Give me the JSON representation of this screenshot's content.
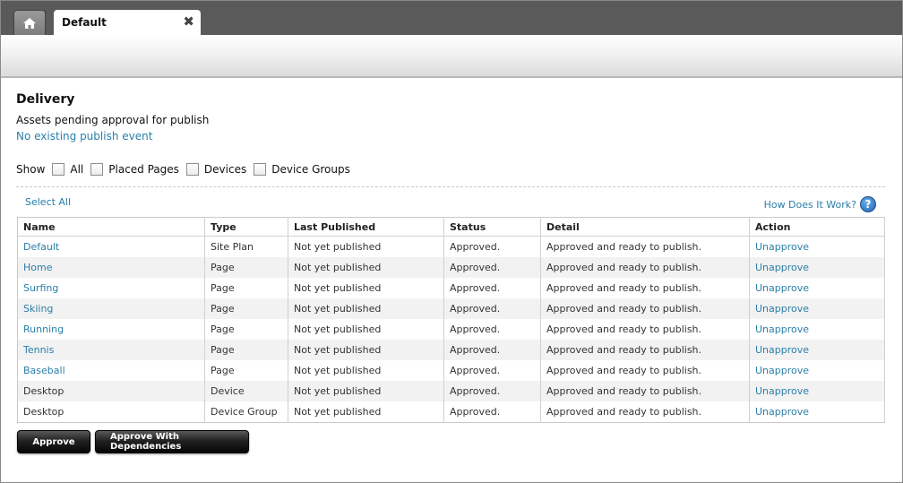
{
  "tabs": {
    "home_icon": "home-icon",
    "active_tab_label": "Default",
    "close_glyph": "✖"
  },
  "page": {
    "title": "Delivery",
    "subtitle": "Assets pending approval for publish",
    "no_event_link": "No existing publish event"
  },
  "filters": {
    "show_label": "Show",
    "options": [
      {
        "label": "All",
        "checked": false
      },
      {
        "label": "Placed Pages",
        "checked": false
      },
      {
        "label": "Devices",
        "checked": false
      },
      {
        "label": "Device Groups",
        "checked": false
      }
    ]
  },
  "links": {
    "select_all": "Select All",
    "how_does_it_work": "How Does It Work?",
    "help_glyph": "?"
  },
  "table": {
    "headers": [
      "Name",
      "Type",
      "Last Published",
      "Status",
      "Detail",
      "Action"
    ],
    "rows": [
      {
        "name": "Default",
        "name_link": true,
        "type": "Site Plan",
        "last_published": "Not yet published",
        "status": "Approved.",
        "detail": "Approved and ready to publish.",
        "action": "Unapprove"
      },
      {
        "name": "Home",
        "name_link": true,
        "type": "Page",
        "last_published": "Not yet published",
        "status": "Approved.",
        "detail": "Approved and ready to publish.",
        "action": "Unapprove"
      },
      {
        "name": "Surfing",
        "name_link": true,
        "type": "Page",
        "last_published": "Not yet published",
        "status": "Approved.",
        "detail": "Approved and ready to publish.",
        "action": "Unapprove"
      },
      {
        "name": "Skiing",
        "name_link": true,
        "type": "Page",
        "last_published": "Not yet published",
        "status": "Approved.",
        "detail": "Approved and ready to publish.",
        "action": "Unapprove"
      },
      {
        "name": "Running",
        "name_link": true,
        "type": "Page",
        "last_published": "Not yet published",
        "status": "Approved.",
        "detail": "Approved and ready to publish.",
        "action": "Unapprove"
      },
      {
        "name": "Tennis",
        "name_link": true,
        "type": "Page",
        "last_published": "Not yet published",
        "status": "Approved.",
        "detail": "Approved and ready to publish.",
        "action": "Unapprove"
      },
      {
        "name": "Baseball",
        "name_link": true,
        "type": "Page",
        "last_published": "Not yet published",
        "status": "Approved.",
        "detail": "Approved and ready to publish.",
        "action": "Unapprove"
      },
      {
        "name": "Desktop",
        "name_link": false,
        "type": "Device",
        "last_published": "Not yet published",
        "status": "Approved.",
        "detail": "Approved and ready to publish.",
        "action": "Unapprove"
      },
      {
        "name": "Desktop",
        "name_link": false,
        "type": "Device Group",
        "last_published": "Not yet published",
        "status": "Approved.",
        "detail": "Approved and ready to publish.",
        "action": "Unapprove"
      }
    ]
  },
  "buttons": {
    "approve": "Approve",
    "approve_with_dependencies": "Approve With Dependencies"
  },
  "colors": {
    "link": "#2a7fa8",
    "topbar": "#5a5a5a",
    "button": "#111111"
  }
}
